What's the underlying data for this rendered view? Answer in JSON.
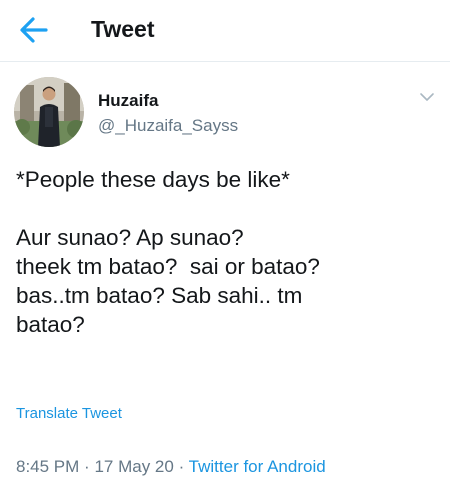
{
  "header": {
    "back_icon": "back-arrow-icon",
    "title": "Tweet",
    "accent_color": "#1da1f2"
  },
  "tweet": {
    "author_name": "Huzaifa",
    "author_handle": "@_Huzaifa_Sayss",
    "menu_icon": "chevron-down-icon",
    "text": "*People these days be like*\n\nAur sunao? Ap sunao?\ntheek tm batao?  sai or batao?\nbas..tm batao? Sab sahi.. tm\nbatao?",
    "translate_label": "Translate Tweet",
    "time": "8:45 PM",
    "separator": "·",
    "date": "17 May 20",
    "source": "Twitter for Android",
    "link_color": "#1b95e0"
  }
}
